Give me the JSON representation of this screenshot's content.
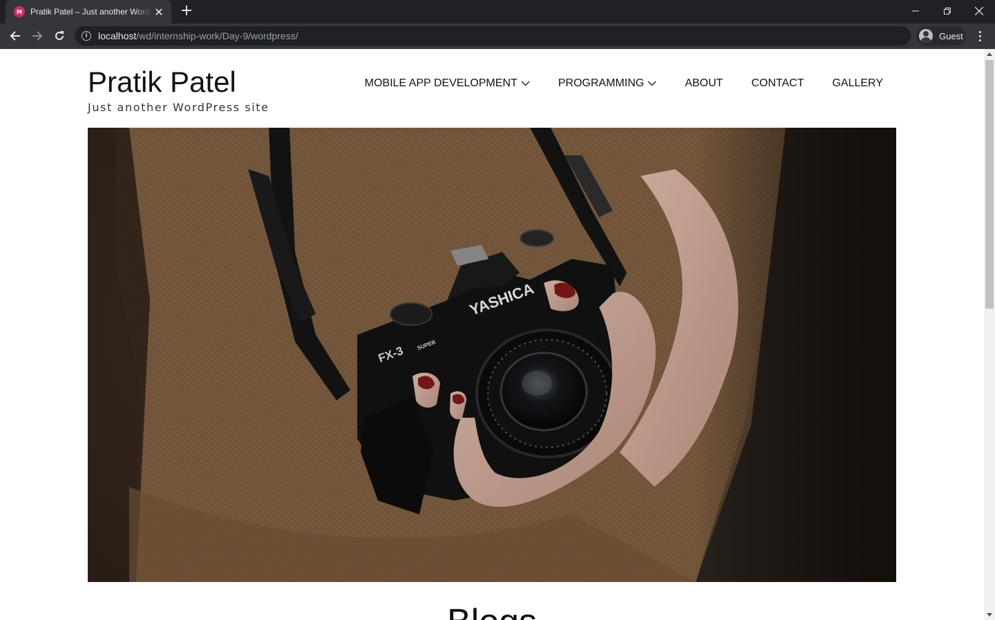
{
  "browser": {
    "tab_title": "Pratik Patel – Just another WordPress site",
    "favicon_letter": "M",
    "url_host": "localhost",
    "url_path": "/wd/internship-work/Day-9/wordpress/",
    "profile_label": "Guest"
  },
  "site": {
    "title": "Pratik Patel",
    "description": "Just another WordPress site"
  },
  "nav": {
    "items": [
      {
        "label": "MOBILE APP DEVELOPMENT",
        "has_dropdown": true
      },
      {
        "label": "PROGRAMMING",
        "has_dropdown": true
      },
      {
        "label": "ABOUT",
        "has_dropdown": false
      },
      {
        "label": "CONTACT",
        "has_dropdown": false
      },
      {
        "label": "GALLERY",
        "has_dropdown": false
      }
    ]
  },
  "hero": {
    "camera_brand": "YASHICA",
    "camera_model": "FX-3",
    "camera_model_suffix": "SUPER"
  },
  "section": {
    "heading": "Blogs"
  }
}
